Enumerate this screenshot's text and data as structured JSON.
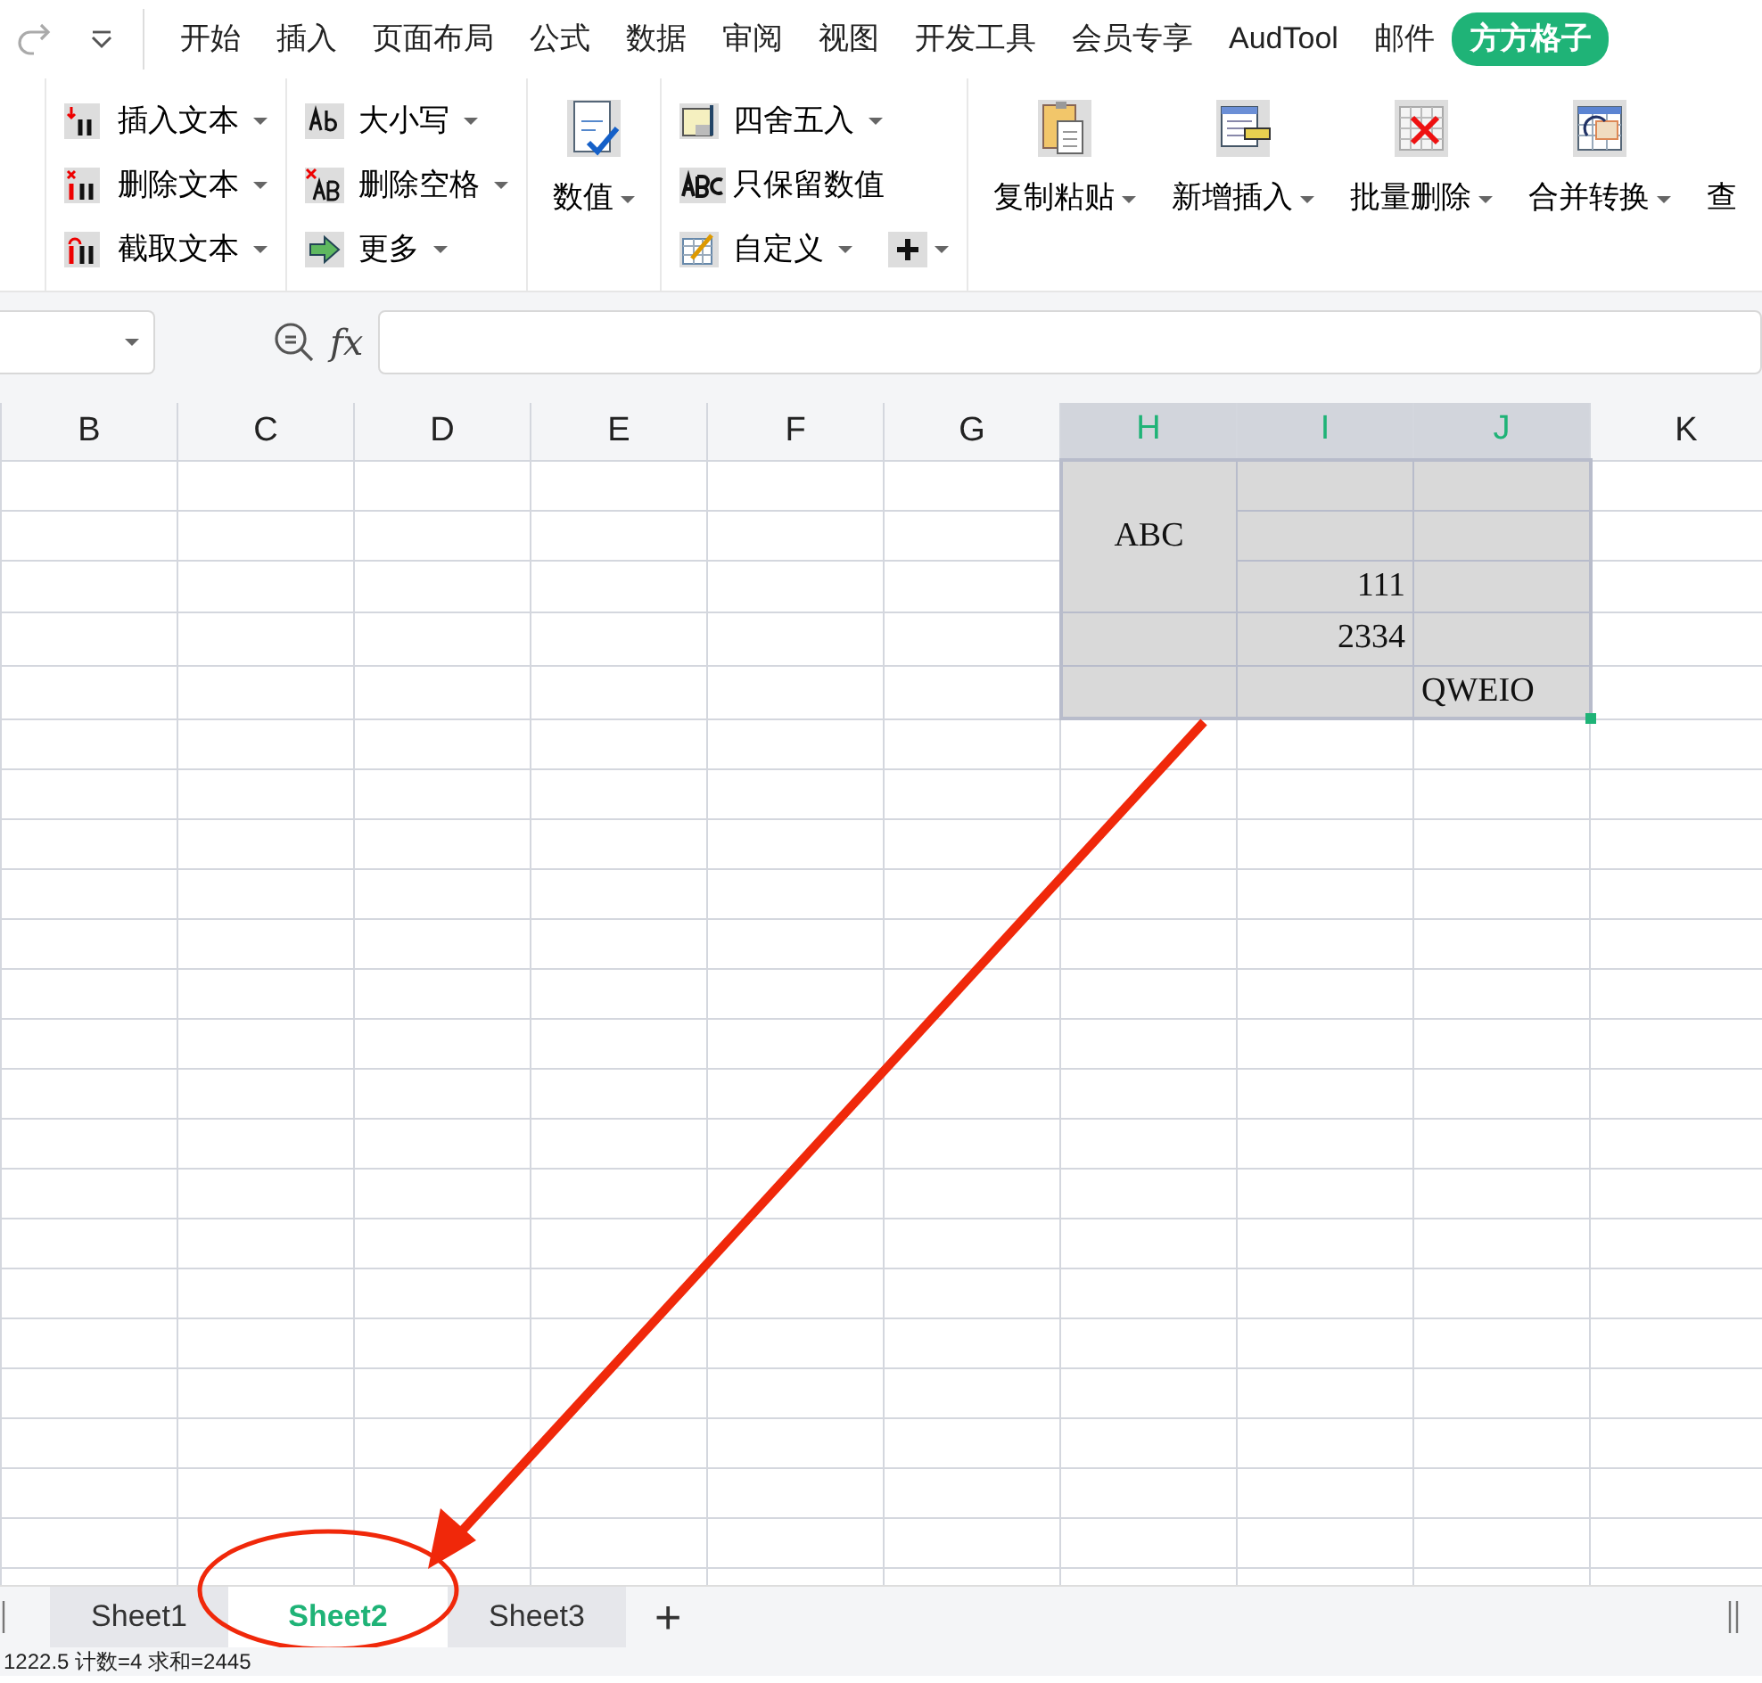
{
  "menu_tabs": [
    {
      "label": "开始",
      "selected": false
    },
    {
      "label": "插入",
      "selected": false
    },
    {
      "label": "页面布局",
      "selected": false
    },
    {
      "label": "公式",
      "selected": false
    },
    {
      "label": "数据",
      "selected": false
    },
    {
      "label": "审阅",
      "selected": false
    },
    {
      "label": "视图",
      "selected": false
    },
    {
      "label": "开发工具",
      "selected": false
    },
    {
      "label": "会员专享",
      "selected": false
    },
    {
      "label": "AudTool",
      "selected": false
    },
    {
      "label": "邮件",
      "selected": false
    },
    {
      "label": "方方格子",
      "selected": true
    }
  ],
  "ribbon_groups": [
    {
      "kind": "small",
      "items": [
        {
          "label": "插入文本",
          "dropdown": true
        },
        {
          "label": "删除文本",
          "dropdown": true
        },
        {
          "label": "截取文本",
          "dropdown": true
        }
      ]
    },
    {
      "kind": "small",
      "items": [
        {
          "label": "大小写",
          "dropdown": true
        },
        {
          "label": "删除空格",
          "dropdown": true
        },
        {
          "label": "更多",
          "dropdown": true
        }
      ]
    },
    {
      "kind": "large",
      "items": [
        {
          "label": "数值",
          "dropdown": true
        }
      ]
    },
    {
      "kind": "small",
      "items": [
        {
          "label": "四舍五入",
          "dropdown": true
        },
        {
          "label": "只保留数值",
          "dropdown": false
        },
        {
          "label": "自定义",
          "dropdown": true
        }
      ]
    },
    {
      "kind": "large",
      "items": [
        {
          "label": "复制粘贴",
          "dropdown": true
        },
        {
          "label": "新增插入",
          "dropdown": true
        },
        {
          "label": "批量删除",
          "dropdown": true
        },
        {
          "label": "合并转换",
          "dropdown": true
        },
        {
          "label": "查",
          "dropdown": false
        }
      ]
    }
  ],
  "formula_bar": {
    "fx": "fx"
  },
  "columns": [
    {
      "label": "B",
      "selected": false
    },
    {
      "label": "C",
      "selected": false
    },
    {
      "label": "D",
      "selected": false
    },
    {
      "label": "E",
      "selected": false
    },
    {
      "label": "F",
      "selected": false
    },
    {
      "label": "G",
      "selected": false
    },
    {
      "label": "H",
      "selected": true
    },
    {
      "label": "I",
      "selected": true
    },
    {
      "label": "J",
      "selected": true
    },
    {
      "label": "K",
      "selected": false
    }
  ],
  "selection_rows": [
    {
      "cells": [
        {
          "kind": "merged_text",
          "text": "ABC"
        },
        {
          "kind": "blank"
        },
        {
          "kind": "blank"
        }
      ]
    },
    {
      "cells": [
        {
          "kind": "merged_cont"
        },
        {
          "kind": "blank"
        },
        {
          "kind": "blank"
        }
      ]
    },
    {
      "cells": [
        {
          "kind": "merged_cont"
        },
        {
          "kind": "number",
          "text": "111"
        },
        {
          "kind": "blank"
        }
      ]
    },
    {
      "cells": [
        {
          "kind": "blank"
        },
        {
          "kind": "number",
          "text": "2334"
        },
        {
          "kind": "blank"
        }
      ]
    },
    {
      "cells": [
        {
          "kind": "blank"
        },
        {
          "kind": "blank"
        },
        {
          "kind": "text",
          "text": "QWEIO"
        }
      ]
    }
  ],
  "sheet_tabs": [
    {
      "label": "Sheet1",
      "selected": false
    },
    {
      "label": "Sheet2",
      "selected": true
    },
    {
      "label": "Sheet3",
      "selected": false
    }
  ],
  "add_sheet": "+",
  "status_bar": "1222.5 计数=4 求和=2445"
}
